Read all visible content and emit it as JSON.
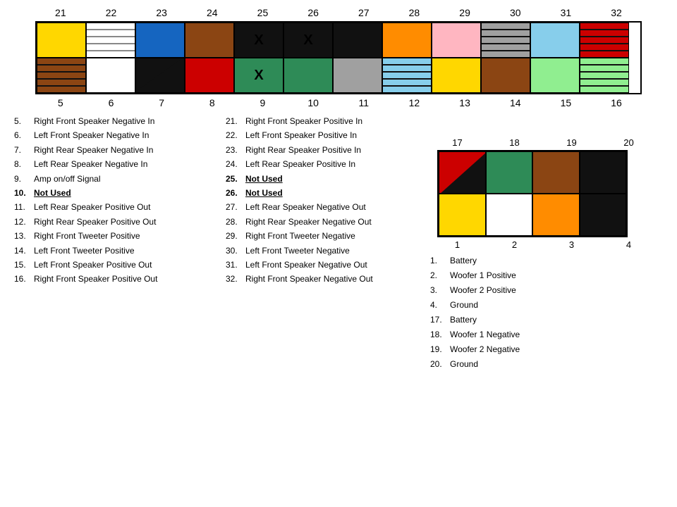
{
  "topConnector": {
    "pinNumbersTop": [
      "21",
      "22",
      "23",
      "24",
      "25",
      "26",
      "27",
      "28",
      "29",
      "30",
      "31",
      "32"
    ],
    "pinNumbersBottom": [
      "5",
      "6",
      "7",
      "8",
      "9",
      "10",
      "11",
      "12",
      "13",
      "14",
      "15",
      "16"
    ],
    "row1": [
      {
        "color": "yellow",
        "label": ""
      },
      {
        "color": "white-striped",
        "label": ""
      },
      {
        "color": "blue",
        "label": ""
      },
      {
        "color": "brown",
        "label": ""
      },
      {
        "color": "black",
        "label": "X"
      },
      {
        "color": "black",
        "label": "X"
      },
      {
        "color": "black",
        "label": ""
      },
      {
        "color": "orange",
        "label": ""
      },
      {
        "color": "pink",
        "label": ""
      },
      {
        "color": "white-striped",
        "label": ""
      },
      {
        "color": "ltblue",
        "label": ""
      },
      {
        "color": "red-striped",
        "label": ""
      }
    ],
    "row2": [
      {
        "color": "brown-striped",
        "label": ""
      },
      {
        "color": "white",
        "label": ""
      },
      {
        "color": "diagonal-bw",
        "label": ""
      },
      {
        "color": "red",
        "label": ""
      },
      {
        "color": "green",
        "label": "X"
      },
      {
        "color": "green",
        "label": ""
      },
      {
        "color": "gray",
        "label": ""
      },
      {
        "color": "gray-striped",
        "label": ""
      },
      {
        "color": "yellow",
        "label": ""
      },
      {
        "color": "brown",
        "label": ""
      },
      {
        "color": "ltgreen",
        "label": ""
      },
      {
        "color": "ltgreen-striped",
        "label": ""
      }
    ]
  },
  "legendLeft": [
    {
      "num": "5.",
      "text": "Right Front Speaker Negative In",
      "bold": false,
      "underline": false
    },
    {
      "num": "6.",
      "text": "Left Front Speaker Negative In",
      "bold": false,
      "underline": false
    },
    {
      "num": "7.",
      "text": "Right Rear Speaker Negative In",
      "bold": false,
      "underline": false
    },
    {
      "num": "8.",
      "text": "Left Rear Speaker Negative In",
      "bold": false,
      "underline": false
    },
    {
      "num": "9.",
      "text": "Amp on/off Signal",
      "bold": false,
      "underline": false
    },
    {
      "num": "10.",
      "text": "Not Used",
      "bold": true,
      "underline": true
    },
    {
      "num": "11.",
      "text": "Left Rear Speaker Positive Out",
      "bold": false,
      "underline": false
    },
    {
      "num": "12.",
      "text": "Right Rear Speaker Positive Out",
      "bold": false,
      "underline": false
    },
    {
      "num": "13.",
      "text": "Right Front Tweeter Positive",
      "bold": false,
      "underline": false
    },
    {
      "num": "14.",
      "text": "Left Front Tweeter Positive",
      "bold": false,
      "underline": false
    },
    {
      "num": "15.",
      "text": "Left Front Speaker Positive Out",
      "bold": false,
      "underline": false
    },
    {
      "num": "16.",
      "text": "Right Front Speaker Positive Out",
      "bold": false,
      "underline": false
    }
  ],
  "legendRight": [
    {
      "num": "21.",
      "text": "Right Front Speaker Positive In",
      "bold": false,
      "underline": false
    },
    {
      "num": "22.",
      "text": "Left Front Speaker Positive In",
      "bold": false,
      "underline": false
    },
    {
      "num": "23.",
      "text": "Right Rear Speaker Positive In",
      "bold": false,
      "underline": false
    },
    {
      "num": "24.",
      "text": "Left Rear Speaker Positive In",
      "bold": false,
      "underline": false
    },
    {
      "num": "25.",
      "text": "Not Used",
      "bold": true,
      "underline": true
    },
    {
      "num": "26.",
      "text": "Not Used",
      "bold": true,
      "underline": true
    },
    {
      "num": "27.",
      "text": "Left Rear Speaker Negative Out",
      "bold": false,
      "underline": false
    },
    {
      "num": "28.",
      "text": "Right Rear Speaker Negative Out",
      "bold": false,
      "underline": false
    },
    {
      "num": "29.",
      "text": "Right Front Tweeter Negative",
      "bold": false,
      "underline": false
    },
    {
      "num": "30.",
      "text": "Left Front Tweeter Negative",
      "bold": false,
      "underline": false
    },
    {
      "num": "31.",
      "text": "Left Front Speaker Negative Out",
      "bold": false,
      "underline": false
    },
    {
      "num": "32.",
      "text": "Right Front Speaker Negative Out",
      "bold": false,
      "underline": false
    }
  ],
  "smallConnector": {
    "pinNumbersTop": [
      "17",
      "18",
      "19",
      "20"
    ],
    "pinNumbersBottom": [
      "1",
      "2",
      "3",
      "4"
    ],
    "row1": [
      {
        "type": "diag-red-black"
      },
      {
        "color": "#2E8B57"
      },
      {
        "color": "#8B4513"
      },
      {
        "color": "#111"
      }
    ],
    "row2": [
      {
        "color": "#FFD700"
      },
      {
        "color": "#fff"
      },
      {
        "color": "#FF8C00"
      },
      {
        "color": "#111"
      }
    ]
  },
  "smallLegend": [
    {
      "num": "1.",
      "text": "Battery"
    },
    {
      "num": "2.",
      "text": "Woofer 1 Positive"
    },
    {
      "num": "3.",
      "text": "Woofer 2 Positive"
    },
    {
      "num": "4.",
      "text": "Ground"
    },
    {
      "num": "17.",
      "text": "Battery"
    },
    {
      "num": "18.",
      "text": "Woofer 1 Negative"
    },
    {
      "num": "19.",
      "text": "Woofer 2 Negative"
    },
    {
      "num": "20.",
      "text": "Ground"
    }
  ]
}
